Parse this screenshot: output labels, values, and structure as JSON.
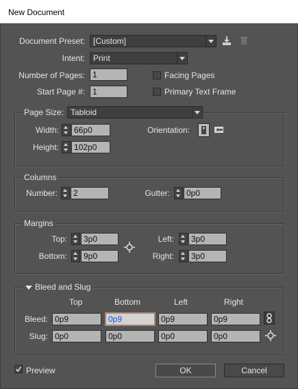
{
  "window": {
    "title": "New Document"
  },
  "preset": {
    "label": "Document Preset:",
    "value": "[Custom]"
  },
  "intent": {
    "label": "Intent:",
    "value": "Print"
  },
  "pages": {
    "number_label": "Number of Pages:",
    "number_value": "1",
    "start_label": "Start Page #:",
    "start_value": "1",
    "facing_label": "Facing Pages",
    "facing_checked": false,
    "primary_label": "Primary Text Frame",
    "primary_checked": false
  },
  "page_size": {
    "label": "Page Size:",
    "value": "Tabloid",
    "width_label": "Width:",
    "width_value": "66p0",
    "height_label": "Height:",
    "height_value": "102p0",
    "orientation_label": "Orientation:"
  },
  "columns": {
    "group_label": "Columns",
    "number_label": "Number:",
    "number_value": "2",
    "gutter_label": "Gutter:",
    "gutter_value": "0p0"
  },
  "margins": {
    "group_label": "Margins",
    "top_label": "Top:",
    "top_value": "3p0",
    "bottom_label": "Bottom:",
    "bottom_value": "9p0",
    "left_label": "Left:",
    "left_value": "3p0",
    "right_label": "Right:",
    "right_value": "3p0"
  },
  "bleed_slug": {
    "group_label": "Bleed and Slug",
    "col_top": "Top",
    "col_bottom": "Bottom",
    "col_left": "Left",
    "col_right": "Right",
    "bleed_label": "Bleed:",
    "bleed_top": "0p9",
    "bleed_bottom": "0p9",
    "bleed_left": "0p9",
    "bleed_right": "0p9",
    "slug_label": "Slug:",
    "slug_top": "0p0",
    "slug_bottom": "0p0",
    "slug_left": "0p0",
    "slug_right": "0p0"
  },
  "footer": {
    "preview_label": "Preview",
    "preview_checked": true,
    "ok_label": "OK",
    "cancel_label": "Cancel"
  },
  "colors": {
    "dialog_bg": "#535353",
    "field_bg": "#b4b4b4",
    "focus": "#e07b2e",
    "title_bg": "#ffffff"
  }
}
